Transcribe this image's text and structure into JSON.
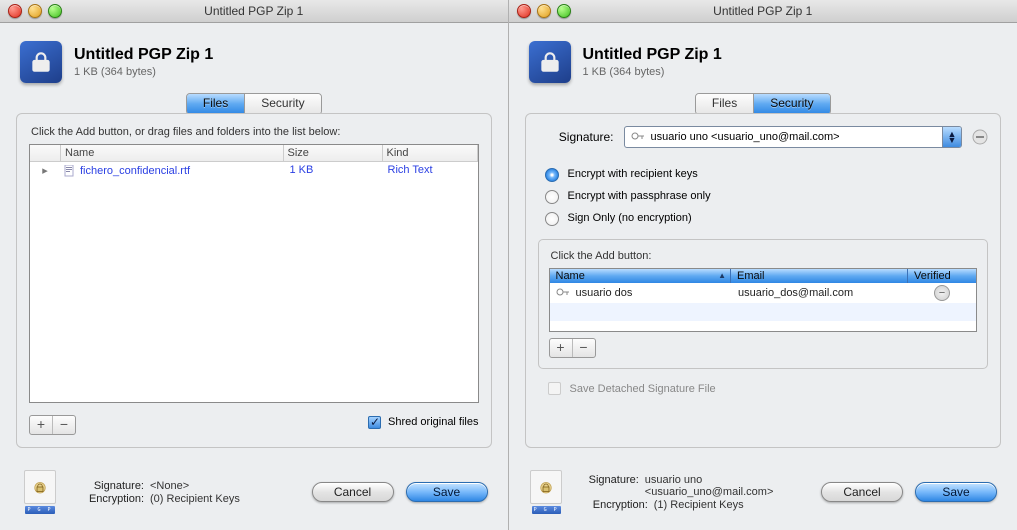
{
  "left": {
    "window_title": "Untitled PGP Zip 1",
    "doc_title": "Untitled PGP Zip 1",
    "doc_sub": "1 KB (364 bytes)",
    "tabs": {
      "files": "Files",
      "security": "Security",
      "active": "files"
    },
    "instruction": "Click the Add button, or drag files and folders into the list below:",
    "columns": {
      "name": "Name",
      "size": "Size",
      "kind": "Kind"
    },
    "files": [
      {
        "name": "fichero_confidencial.rtf",
        "size": "1 KB",
        "kind": "Rich Text"
      }
    ],
    "shred_label": "Shred original files",
    "shred_checked": true,
    "footer": {
      "signature_label": "Signature:",
      "signature_value": "<None>",
      "encryption_label": "Encryption:",
      "encryption_value": "(0) Recipient Keys",
      "cancel": "Cancel",
      "save": "Save"
    }
  },
  "right": {
    "window_title": "Untitled PGP Zip 1",
    "doc_title": "Untitled PGP Zip 1",
    "doc_sub": "1 KB (364 bytes)",
    "tabs": {
      "files": "Files",
      "security": "Security",
      "active": "security"
    },
    "signature_label": "Signature:",
    "signature_value": "usuario uno <usuario_uno@mail.com>",
    "radios": {
      "recipient": "Encrypt with recipient keys",
      "passphrase": "Encrypt with passphrase only",
      "sign_only": "Sign Only (no encryption)",
      "selected": "recipient"
    },
    "inner_instruction": "Click the Add button:",
    "recip_columns": {
      "name": "Name",
      "email": "Email",
      "verified": "Verified"
    },
    "recipients": [
      {
        "name": "usuario dos",
        "email": "usuario_dos@mail.com"
      }
    ],
    "detached_label": "Save Detached Signature File",
    "detached_checked": false,
    "footer": {
      "signature_label": "Signature:",
      "signature_value": "usuario uno <usuario_uno@mail.com>",
      "encryption_label": "Encryption:",
      "encryption_value": "(1) Recipient Keys",
      "cancel": "Cancel",
      "save": "Save"
    }
  }
}
